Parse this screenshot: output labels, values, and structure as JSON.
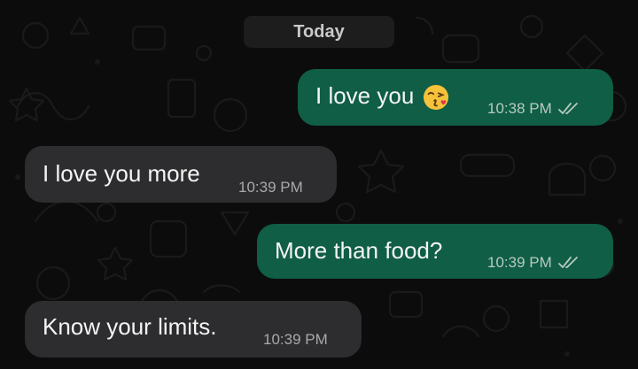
{
  "date_chip": "Today",
  "messages": [
    {
      "direction": "out",
      "text": "I love you",
      "emoji": "kissing-face-emoji",
      "time": "10:38 PM",
      "status": "read-double-check-icon"
    },
    {
      "direction": "in",
      "text": "I love you more",
      "time": "10:39 PM"
    },
    {
      "direction": "out",
      "text": "More than food?",
      "time": "10:39 PM",
      "status": "read-double-check-icon"
    },
    {
      "direction": "in",
      "text": "Know your limits.",
      "time": "10:39 PM"
    }
  ],
  "colors": {
    "background": "#0c0c0c",
    "outgoing_bubble": "#0f5e45",
    "incoming_bubble": "#2d2d2f",
    "date_chip": "#1d1d1d"
  }
}
